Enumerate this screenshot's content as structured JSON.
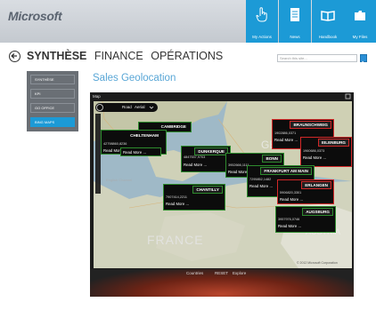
{
  "brand": {
    "logo_text": "Microsoft"
  },
  "tiles": [
    {
      "label": "My Actions",
      "icon": "hand-pointer-icon"
    },
    {
      "label": "News",
      "icon": "document-icon"
    },
    {
      "label": "Handbook",
      "icon": "open-book-icon"
    },
    {
      "label": "My Files",
      "icon": "folder-icon"
    }
  ],
  "nav": {
    "back_icon": "back-arrow-icon",
    "items": [
      "SYNTHÈSE",
      "FINANCE",
      "OPÉRATIONS"
    ],
    "active_index": 0
  },
  "search": {
    "placeholder": "Search this site...",
    "icon": "search-arrow-icon"
  },
  "menu": {
    "items": [
      "SYNTHÈSE",
      "KPI",
      "GO OFFICE",
      "BING MAPS"
    ],
    "selected_index": 3
  },
  "page_title": "Sales Geolocation",
  "map": {
    "header": "Map",
    "mode_label": "Road",
    "mode_value": "Aerial",
    "background_labels": [
      "FRANCE",
      "English Channel",
      "AUSTRIA",
      "GE"
    ],
    "pins": [
      {
        "name": "CAMBRIDGE",
        "status": "green"
      },
      {
        "name": "CHELTENHAM",
        "status": "green",
        "value": "42798860,8236",
        "link": "Read More ..."
      },
      {
        "name": "DUNKERQUE",
        "status": "green",
        "value": "4847537,9703",
        "link": "Read More ..."
      },
      {
        "name": "CHANTILLY",
        "status": "green",
        "value": "7907414,2211",
        "link": "Read More ..."
      },
      {
        "name": "BRAUNSCHWEIG",
        "status": "red",
        "value": "1902886,0371",
        "link": "Read More ..."
      },
      {
        "name": "EILENBURG",
        "status": "red",
        "value": "1960686,0373",
        "link": "Read More ..."
      },
      {
        "name": "BONN",
        "status": "green",
        "value": "3952666,1111",
        "link": "Read More ..."
      },
      {
        "name": "FRANKFURT AM MAIN",
        "status": "green",
        "value": "7295852,1482",
        "link": "Read More ..."
      },
      {
        "name": "ERLANGEN",
        "status": "red",
        "value": "5906820,3301",
        "link": "Read More ..."
      },
      {
        "name": "AUGSBURG",
        "status": "green",
        "value": "3957976,0746",
        "link": "Read More ..."
      }
    ],
    "bottom_bar": [
      "Countries",
      "RESET",
      "Explore"
    ],
    "copyright": "© 2012 Microsoft Corporation"
  }
}
